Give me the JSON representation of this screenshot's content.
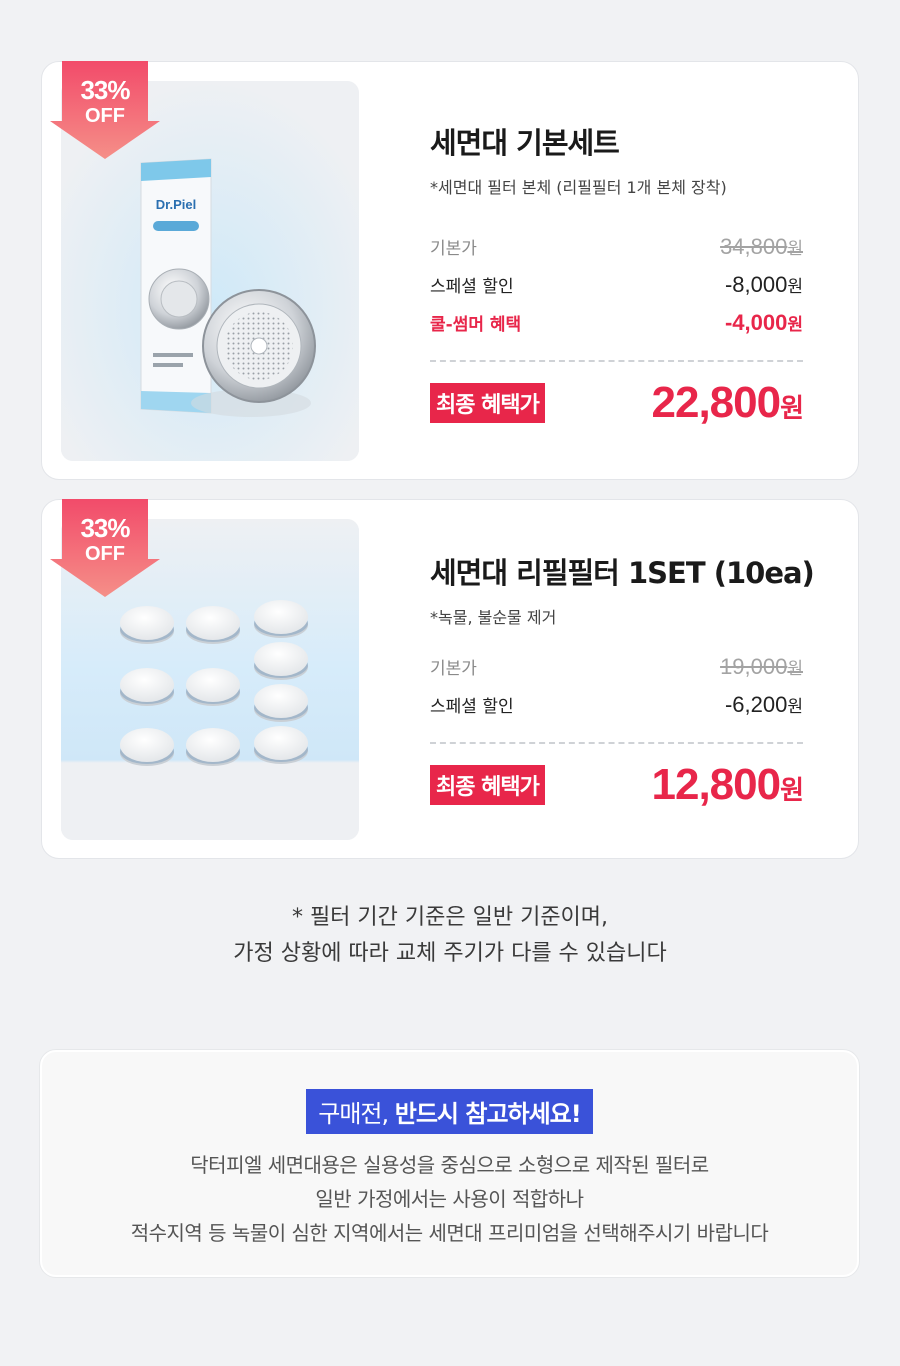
{
  "products": [
    {
      "badge": {
        "percent": "33%",
        "off": "OFF"
      },
      "image": {
        "brand": "Dr.Piel",
        "kind": "showerhead-device"
      },
      "title": "세면대 기본세트",
      "subtitle": "*세면대 필터 본체 (리필필터 1개 본체 장착)",
      "prices": [
        {
          "label": "기본가",
          "amount": "34,800",
          "unit": "원",
          "style": "strike"
        },
        {
          "label": "스페셜 할인",
          "amount": "-8,000",
          "unit": "원",
          "style": "normal"
        },
        {
          "label": "쿨-썸머 혜택",
          "amount": "-4,000",
          "unit": "원",
          "style": "red"
        }
      ],
      "final_label": "최종 혜택가",
      "final_price": "22,800",
      "final_unit": "원"
    },
    {
      "badge": {
        "percent": "33%",
        "off": "OFF"
      },
      "image": {
        "kind": "refill-filters",
        "count": 10
      },
      "title": "세면대 리필필터 1SET (10ea)",
      "subtitle": "*녹물, 불순물 제거",
      "prices": [
        {
          "label": "기본가",
          "amount": "19,000",
          "unit": "원",
          "style": "strike"
        },
        {
          "label": "스페셜 할인",
          "amount": "-6,200",
          "unit": "원",
          "style": "normal"
        }
      ],
      "final_label": "최종 혜택가",
      "final_price": "12,800",
      "final_unit": "원"
    }
  ],
  "note": {
    "line1": "*  필터 기간 기준은 일반 기준이며,",
    "line2": "가정 상황에 따라 교체 주기가 다를 수 있습니다"
  },
  "notice": {
    "title_normal": "구매전, ",
    "title_bold": "반드시 참고하세요!",
    "lines": [
      "닥터피엘 세면대용은 실용성을 중심으로 소형으로 제작된 필터로",
      "일반 가정에서는 사용이 적합하나",
      "적수지역 등 녹물이 심한 지역에서는 세면대 프리미엄을 선택해주시기 바랍니다"
    ]
  },
  "colors": {
    "accent_red": "#e8264a",
    "badge_pink": "#f0566f",
    "notice_blue": "#3a52d9",
    "background": "#f1f2f4"
  }
}
